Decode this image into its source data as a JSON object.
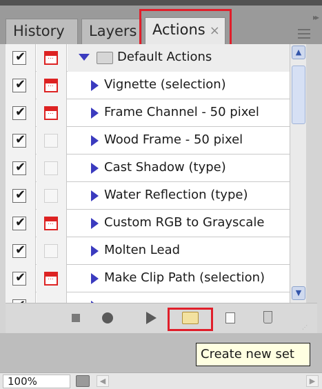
{
  "tabs": [
    {
      "label": "History",
      "active": false
    },
    {
      "label": "Layers",
      "active": false
    },
    {
      "label": "Actions",
      "active": true
    }
  ],
  "tab_close_glyph": "×",
  "panel_icons": [
    "collapse-icon",
    "panel-menu-icon"
  ],
  "action_set": {
    "label": "Default Actions",
    "checked": true,
    "dialog": true,
    "expanded": true
  },
  "actions": [
    {
      "label": "Vignette (selection)",
      "checked": true,
      "dialog": true
    },
    {
      "label": "Frame Channel - 50 pixel",
      "checked": true,
      "dialog": true
    },
    {
      "label": "Wood Frame - 50 pixel",
      "checked": true,
      "dialog": false
    },
    {
      "label": "Cast Shadow (type)",
      "checked": true,
      "dialog": false
    },
    {
      "label": "Water Reflection (type)",
      "checked": true,
      "dialog": false
    },
    {
      "label": "Custom RGB to Grayscale",
      "checked": true,
      "dialog": true
    },
    {
      "label": "Molten Lead",
      "checked": true,
      "dialog": false
    },
    {
      "label": "Make Clip Path (selection)",
      "checked": true,
      "dialog": true
    }
  ],
  "toolbar": {
    "buttons": [
      "stop-icon",
      "record-icon",
      "play-icon",
      "new-set-folder-icon",
      "new-action-icon",
      "trash-icon"
    ]
  },
  "tooltip": "Create new set",
  "status": {
    "zoom": "100%"
  },
  "colors": {
    "highlight": "#e01e2a",
    "play_triangle": "#3b3bbf",
    "dialog_icon": "#dd2222",
    "tooltip_bg": "#ffffe1"
  }
}
